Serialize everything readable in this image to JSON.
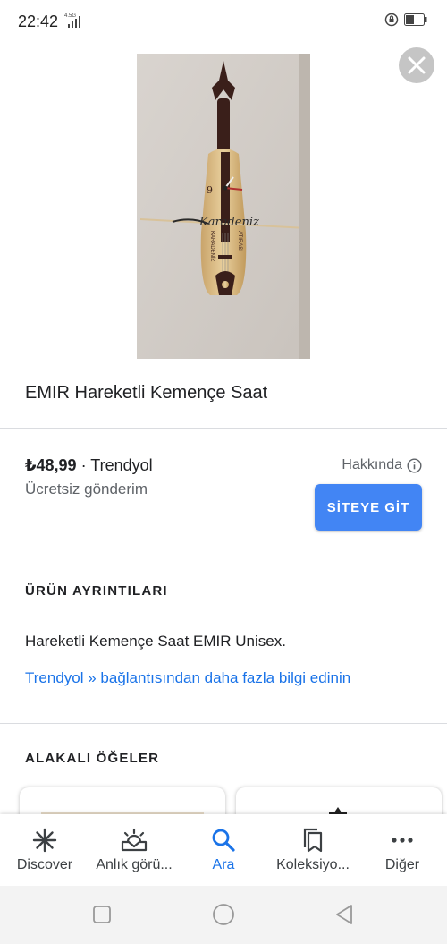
{
  "status_bar": {
    "time": "22:42",
    "network": "4.5G"
  },
  "product": {
    "title": "EMIR Hareketli Kemençe Saat",
    "price": "₺48,99",
    "price_separator": " · ",
    "seller": "Trendyol",
    "shipping": "Ücretsiz gönderim",
    "about_label": "Hakkında",
    "site_button_label": "SİTEYE GİT",
    "image_text": {
      "clock_number": "9",
      "brand": "Karadeniz",
      "left_text": "KARADENİZ",
      "right_text": "ATIRASI"
    }
  },
  "details": {
    "heading": "ÜRÜN AYRINTILARI",
    "description": "Hareketli Kemençe Saat EMIR Unisex.",
    "more_link": "Trendyol » bağlantısından daha fazla bilgi edinin"
  },
  "related": {
    "heading": "ALAKALI ÖĞELER"
  },
  "bottom_nav": {
    "items": [
      {
        "label": "Discover",
        "icon": "asterisk-icon",
        "active": false
      },
      {
        "label": "Anlık görü...",
        "icon": "updates-icon",
        "active": false
      },
      {
        "label": "Ara",
        "icon": "search-icon",
        "active": true
      },
      {
        "label": "Koleksiyo...",
        "icon": "collections-icon",
        "active": false
      },
      {
        "label": "Diğer",
        "icon": "more-icon",
        "active": false
      }
    ]
  },
  "colors": {
    "accent": "#1a73e8",
    "button": "#4285f4",
    "text": "#202124",
    "secondary": "#5f6368"
  }
}
